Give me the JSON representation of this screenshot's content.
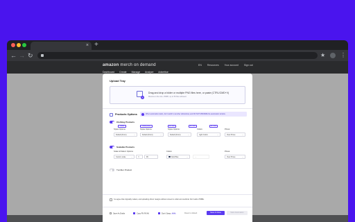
{
  "browser": {
    "new_tab_glyph": "+",
    "close_glyph": "×",
    "back_glyph": "←",
    "forward_glyph": "→",
    "reload_glyph": "↻",
    "star_glyph": "★",
    "menu_glyph": "⋮"
  },
  "site": {
    "logo_brand": "amazon",
    "logo_rest": " merch on demand",
    "header_links": [
      "EN",
      "Resources",
      "Your account",
      "Sign out"
    ],
    "subnav": [
      "Dashboard",
      "Create",
      "Manage",
      "Analyze",
      "Advertise"
    ]
  },
  "modal": {
    "upload_title": "Upload Tray",
    "drop_text": "Drag and drop a folder or multiple PNG files here, or paste (CTRL/CMD+V)",
    "drop_subtext": "Maximum file size: 25MB, up to 50 files allowed.",
    "products_title": "Products Options",
    "info_banner": "When automation starts, don't switch to another tab/window, and DO NOT MINIMIZE the automation window.",
    "clothing_label": "Clothing Products",
    "clothing_chips": [
      "Default",
      "Default (Front)",
      "All Colors",
      "All Colors",
      "All Colors"
    ],
    "style_options_label": "Styles Options:",
    "colors_label": "Colors:",
    "prices_label": "Prices:",
    "style_values": [
      "Default (Front)",
      "Default (Front)",
      "Default (Front)"
    ],
    "color_value": "Light Colors",
    "price_value": "View Prices",
    "scalable_label": "Scalable Products",
    "scale_label": "Scale & Pattern Options:",
    "scale_value": "Custom scale",
    "scale_number": "99",
    "scale_color_value": "Dark Blue",
    "tumbler_label": "Tumbler Product",
    "agree_text": "I've agree that originality matters, and uploading others' designs without consent is unfair and unethical. Don't add a TRIBE.",
    "save_drafts": "Save As Drafts",
    "copy_all": "Copy FN Fill All",
    "dont_swap": "Don't Swap",
    "beta": "BETA",
    "reset_default": "Reset to default",
    "save_close": "Save & Close",
    "start_automation": "Start Automation"
  },
  "colors": {
    "accent": "#5b3bf0",
    "background": "#4a14ee"
  }
}
